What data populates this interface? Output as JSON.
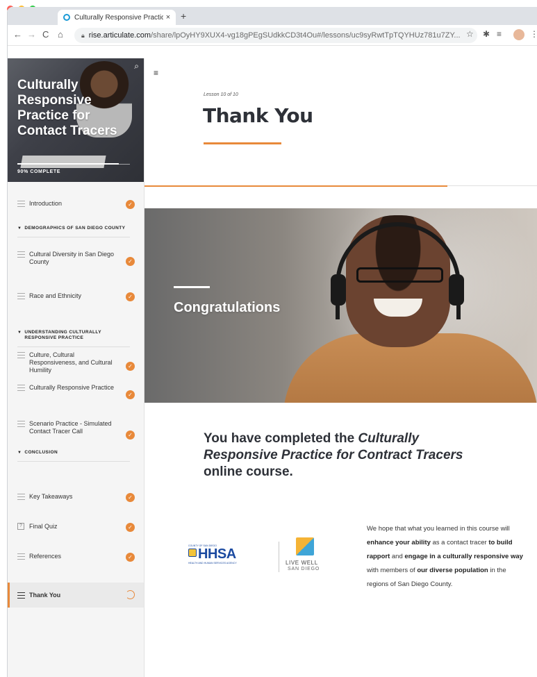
{
  "browser": {
    "tab_title": "Culturally Responsive Practice",
    "tab_close": "×",
    "new_tab": "+",
    "url_host": "rise.articulate.com",
    "url_path": "/share/lpOyHY9XUX4-vg18gPEgSUdkkCD3t4Ou#/lessons/uc9syRwtTpTQYHUz781u7ZY...",
    "back_icon": "←",
    "forward_icon": "→",
    "reload_icon": "C",
    "home_icon": "⌂",
    "colors": {
      "close": "#fd5f57",
      "minimize": "#febc2e",
      "maximize": "#28c840"
    }
  },
  "sidebar": {
    "course_title": "Culturally Responsive Practice for Contact Tracers",
    "progress_text": "90% COMPLETE",
    "progress_fraction": 0.9,
    "items": [
      {
        "label": "Introduction",
        "status": "complete"
      },
      {
        "section": "DEMOGRAPHICS OF SAN DIEGO COUNTY"
      },
      {
        "label": "Cultural Diversity in San Diego County",
        "status": "complete"
      },
      {
        "label": "Race and Ethnicity",
        "status": "complete"
      },
      {
        "section": "UNDERSTANDING CULTURALLY RESPONSIVE PRACTICE"
      },
      {
        "label": "Culture, Cultural Responsiveness, and Cultural Humility",
        "status": "complete"
      },
      {
        "label": "Culturally Responsive Practice",
        "status": "complete"
      },
      {
        "label": "Scenario Practice - Simulated Contact Tracer Call",
        "status": "complete"
      },
      {
        "section": "CONCLUSION"
      },
      {
        "label": "Key Takeaways",
        "status": "complete"
      },
      {
        "label": "Final Quiz",
        "status": "complete"
      },
      {
        "label": "References",
        "status": "complete"
      },
      {
        "label": "Thank You",
        "status": "in-progress"
      }
    ],
    "check_glyph": "✓",
    "caret_glyph": "▼"
  },
  "main": {
    "menu_icon": "≡",
    "lesson_number": "Lesson 10 of 10",
    "lesson_title": "Thank You",
    "lesson_progress_fraction": 0.77,
    "banner_text": "Congratulations",
    "completion_prefix": "You have completed the ",
    "completion_course": "Culturally Responsive Practice for Contract Tracers",
    "completion_suffix": " online course.",
    "logo_county": "COUNTY OF SAN DIEGO",
    "logo_hhsa": "HHSA",
    "logo_hhsa_sub": "HEALTH AND HUMAN SERVICES AGENCY",
    "logo_live_well": "LIVE WELL",
    "logo_san_diego": "SAN DIEGO",
    "hope": {
      "p1": "We hope that what you learned in this course will ",
      "b1": "enhance your ability",
      "p2": " as a contact tracer ",
      "b2": "to build rapport",
      "p3": " and ",
      "b3": "engage in a culturally responsive way",
      "p4": " with members of ",
      "b4": "our diverse population",
      "p5": " in the regions of San Diego County."
    }
  },
  "accent_color": "#e8893a"
}
